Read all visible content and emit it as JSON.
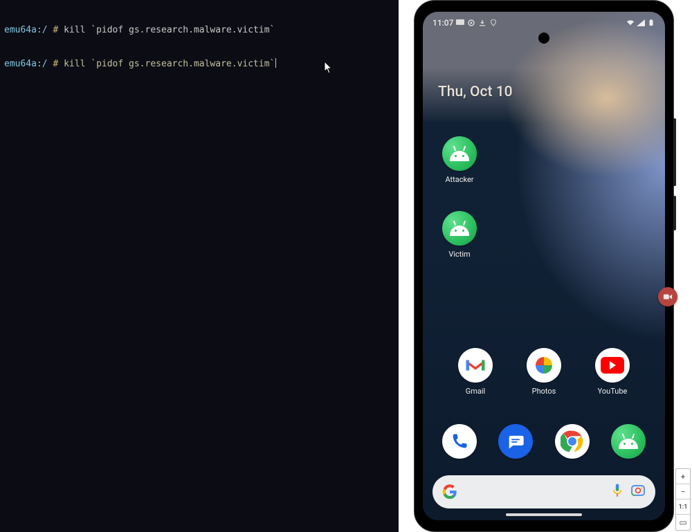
{
  "terminal": {
    "prompt": "emu64a:/",
    "hash": "#",
    "lines": [
      "kill `pidof gs.research.malware.victim`",
      "kill `pidof gs.research.malware.victim`"
    ]
  },
  "emulator": {
    "status_bar": {
      "time": "11:07",
      "icons_left": [
        "message-icon",
        "settings-icon",
        "download-icon",
        "location-icon"
      ],
      "icons_right": [
        "wifi-icon",
        "signal-icon",
        "battery-icon"
      ]
    },
    "date_widget": "Thu, Oct 10",
    "home_apps": [
      {
        "name": "Attacker",
        "icon": "android-green"
      },
      {
        "name": "Victim",
        "icon": "android-green"
      }
    ],
    "app_row": [
      {
        "name": "Gmail",
        "icon": "gmail"
      },
      {
        "name": "Photos",
        "icon": "photos"
      },
      {
        "name": "YouTube",
        "icon": "youtube"
      }
    ],
    "dock": [
      {
        "name": "Phone",
        "icon": "phone"
      },
      {
        "name": "Messages",
        "icon": "messages"
      },
      {
        "name": "Chrome",
        "icon": "chrome"
      },
      {
        "name": "Android",
        "icon": "android-white"
      }
    ],
    "search_bar": {
      "logo": "google",
      "voice": "mic",
      "lens": "lens"
    },
    "toolbar": {
      "zoom_in": "+",
      "zoom_out": "−",
      "fit": "1:1",
      "actual": "▭"
    }
  }
}
